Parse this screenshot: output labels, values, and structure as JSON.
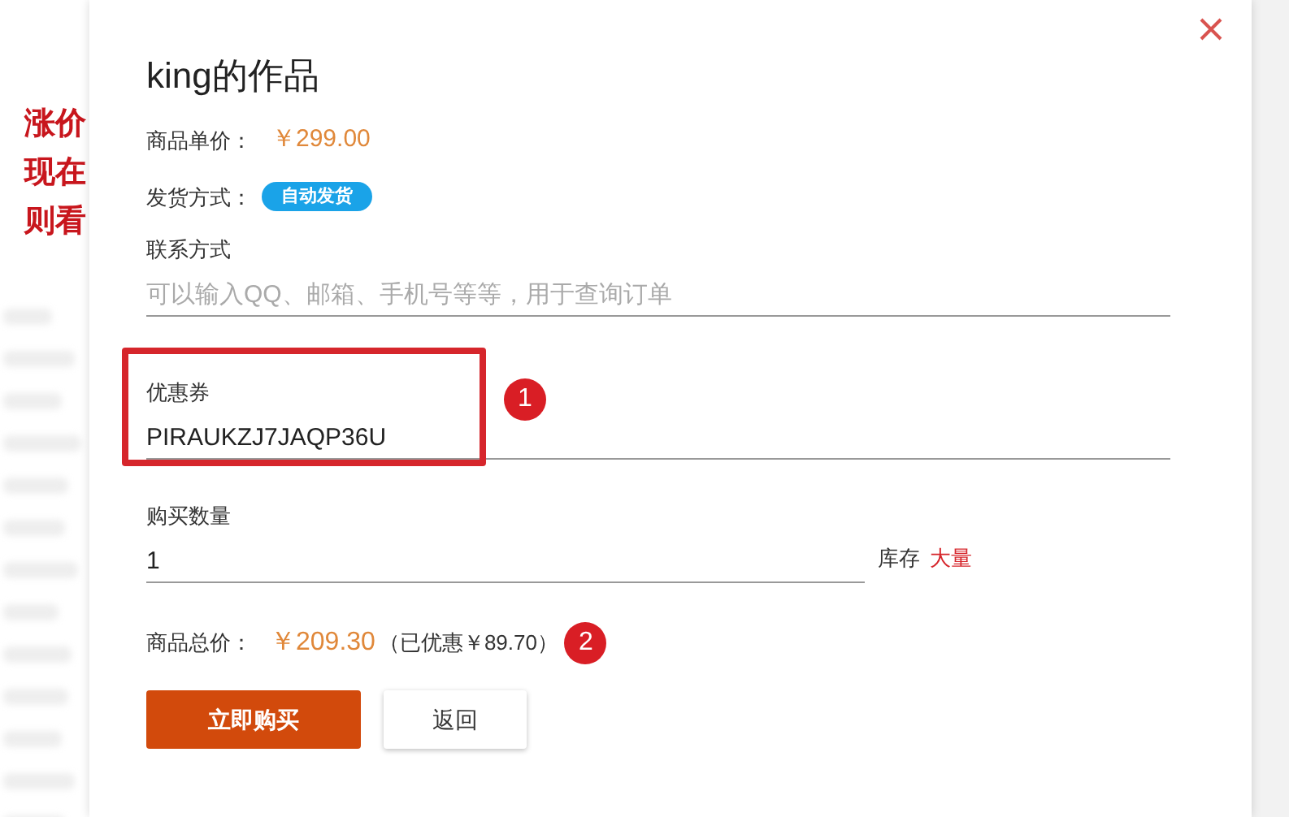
{
  "background_page": {
    "notice_lines": [
      "涨价",
      "现在",
      "则看"
    ]
  },
  "dialog": {
    "title": "king的作品",
    "unit_price": {
      "label": "商品单价：",
      "value": "￥299.00"
    },
    "delivery": {
      "label": "发货方式：",
      "badge": "自动发货"
    },
    "fields": [
      {
        "kind": "text",
        "label": "联系方式",
        "placeholder": "可以输入QQ、邮箱、手机号等等，用于查询订单"
      },
      {
        "kind": "coupon",
        "label": "优惠券",
        "value": "PIRAUKZJ7JAQP36U",
        "annotation": "1"
      },
      {
        "kind": "quantity",
        "label": "购买数量",
        "value": "1",
        "stock_label": "库存",
        "stock_value": "大量"
      }
    ],
    "total": {
      "label": "商品总价：",
      "value": "￥209.30",
      "discount": "（已优惠￥89.70）",
      "annotation": "2"
    },
    "buttons": [
      {
        "kind": "primary",
        "label": "立即购买"
      },
      {
        "kind": "secondary",
        "label": "返回"
      }
    ]
  }
}
